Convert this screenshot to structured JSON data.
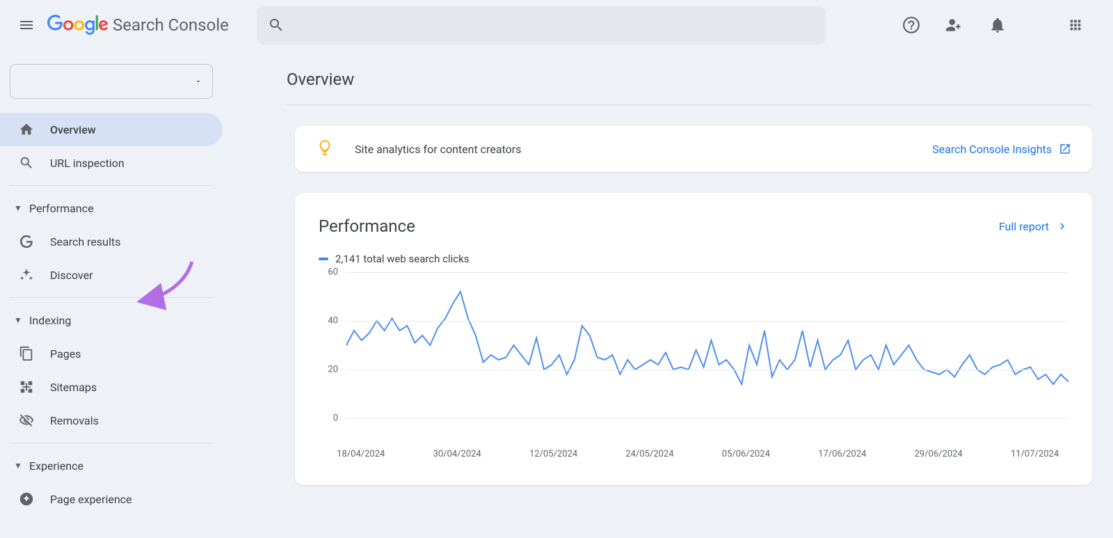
{
  "header": {
    "logo_text": "Search Console",
    "placeholder": ""
  },
  "sidebar": {
    "overview": "Overview",
    "url_inspection": "URL inspection",
    "performance_section": "Performance",
    "search_results": "Search results",
    "discover": "Discover",
    "indexing_section": "Indexing",
    "pages": "Pages",
    "sitemaps": "Sitemaps",
    "removals": "Removals",
    "experience_section": "Experience",
    "page_experience": "Page experience"
  },
  "main": {
    "title": "Overview",
    "insights_text": "Site analytics for content creators",
    "insights_link": "Search Console Insights",
    "perf_title": "Performance",
    "full_report": "Full report",
    "legend_text": "2,141 total web search clicks"
  },
  "chart_data": {
    "type": "line",
    "title": "",
    "xlabel": "",
    "ylabel": "",
    "ylim": [
      0,
      60
    ],
    "y_ticks": [
      0,
      20,
      40,
      60
    ],
    "x_ticks": [
      "18/04/2024",
      "30/04/2024",
      "12/05/2024",
      "24/05/2024",
      "05/06/2024",
      "17/06/2024",
      "29/06/2024",
      "11/07/2024"
    ],
    "x_start": "17/04/2024",
    "x_end": "21/07/2024",
    "values": [
      30,
      36,
      32,
      35,
      40,
      36,
      41,
      36,
      38,
      31,
      34,
      30,
      37,
      41,
      47,
      52,
      41,
      34,
      23,
      26,
      24,
      25,
      30,
      26,
      22,
      33,
      20,
      22,
      26,
      18,
      24,
      38,
      34,
      25,
      24,
      26,
      18,
      24,
      20,
      22,
      24,
      22,
      27,
      20,
      21,
      20,
      28,
      21,
      32,
      22,
      24,
      20,
      14,
      30,
      22,
      36,
      17,
      24,
      20,
      24,
      36,
      21,
      32,
      20,
      24,
      26,
      32,
      20,
      24,
      26,
      20,
      30,
      22,
      26,
      30,
      24,
      20,
      19,
      18,
      20,
      17,
      22,
      26,
      20,
      18,
      21,
      22,
      24,
      18,
      20,
      21,
      16,
      18,
      14,
      18,
      15
    ]
  }
}
